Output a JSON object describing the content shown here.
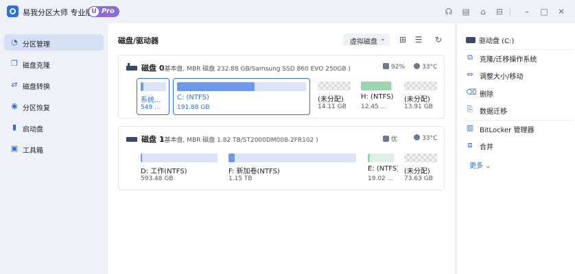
{
  "app": {
    "title": "易我分区大师 专业版",
    "badge_u": "U",
    "badge_pro": "Pro"
  },
  "sidebar": {
    "items": [
      {
        "label": "分区管理",
        "icon": "pie-chart-icon",
        "active": true
      },
      {
        "label": "磁盘克隆",
        "icon": "clone-icon",
        "active": false
      },
      {
        "label": "磁盘转换",
        "icon": "convert-icon",
        "active": false
      },
      {
        "label": "分区恢复",
        "icon": "recovery-icon",
        "active": false
      },
      {
        "label": "启动盘",
        "icon": "usb-icon",
        "active": false
      },
      {
        "label": "工具箱",
        "icon": "toolbox-icon",
        "active": false
      }
    ]
  },
  "main": {
    "title": "磁盘/驱动器",
    "view_select": "虚拟磁盘"
  },
  "disks": [
    {
      "name": "磁盘 0",
      "info": "(基本盘, MBR 磁盘 232.88 GB/Samsung SSD 860 EVO 250GB )",
      "health": "92%",
      "temp": "33°C",
      "partitions": [
        {
          "label": "系统...",
          "size": "549 ...",
          "used": 0.1,
          "type": "normal"
        },
        {
          "label": "C: (NTFS)",
          "size": "191.88 GB",
          "used": 0.6,
          "type": "selected"
        },
        {
          "label": "(未分配)",
          "size": "14.11 GB",
          "used": 0,
          "type": "unalloc"
        },
        {
          "label": "H: (NTFS)",
          "size": "12.45 ...",
          "used": 0.95,
          "type": "green"
        },
        {
          "label": "(未分配)",
          "size": "13.91 GB",
          "used": 0,
          "type": "unalloc"
        }
      ]
    },
    {
      "name": "磁盘 1",
      "info": "(基本盘, MBR 磁盘 1.82 TB/ST2000DM008-2FR102 )",
      "health": "优",
      "temp": "33°C",
      "partitions": [
        {
          "label": "D: 工作(NTFS)",
          "size": "593.48 GB",
          "used": 0.02,
          "type": "normal"
        },
        {
          "label": "F: 新加卷(NTFS)",
          "size": "1.15 TB",
          "used": 0.05,
          "type": "normal"
        },
        {
          "label": "E: (NTFS)",
          "size": "19.02 ...",
          "used": 0.08,
          "type": "green"
        },
        {
          "label": "(未分配)",
          "size": "73.63 GB",
          "used": 0,
          "type": "unalloc"
        }
      ]
    }
  ],
  "right_panel": {
    "header": "驱动盘 (C:)",
    "actions": [
      {
        "label": "克隆/迁移操作系统",
        "icon": "clone-os-icon"
      },
      {
        "label": "调整大小/移动",
        "icon": "resize-icon"
      },
      {
        "label": "删除",
        "icon": "trash-icon"
      },
      {
        "label": "数据迁移",
        "icon": "migrate-icon"
      },
      {
        "label": "BitLocker 管理器",
        "icon": "bitlocker-icon"
      },
      {
        "label": "合并",
        "icon": "merge-icon"
      }
    ],
    "more": "更多"
  }
}
